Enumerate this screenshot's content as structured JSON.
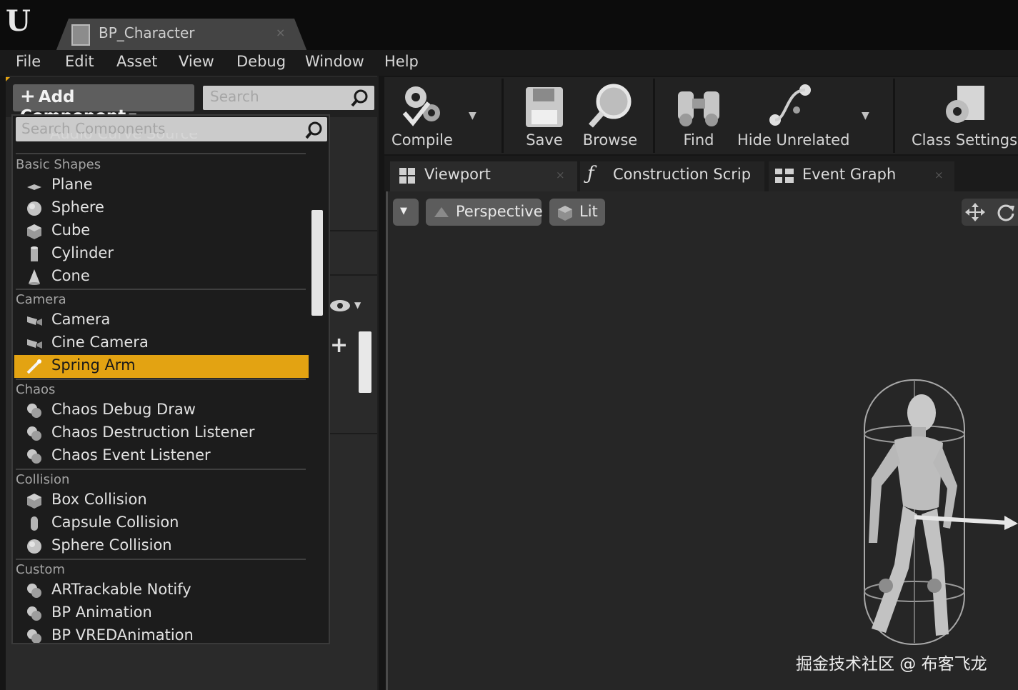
{
  "window": {
    "logo": "U",
    "tab_title": "BP_Character",
    "tab_close": "×"
  },
  "menu": [
    "File",
    "Edit",
    "Asset",
    "View",
    "Debug",
    "Window",
    "Help"
  ],
  "components_panel": {
    "add_component_label": "Add Component",
    "search_placeholder": "Search"
  },
  "component_picker": {
    "search_placeholder": "Search Components",
    "cut_off_item": "Audio Curve Source",
    "categories": [
      {
        "name": "Basic Shapes",
        "items": [
          {
            "label": "Plane",
            "icon": "plane-icon"
          },
          {
            "label": "Sphere",
            "icon": "sphere-icon"
          },
          {
            "label": "Cube",
            "icon": "cube-icon"
          },
          {
            "label": "Cylinder",
            "icon": "cylinder-icon"
          },
          {
            "label": "Cone",
            "icon": "cone-icon"
          }
        ]
      },
      {
        "name": "Camera",
        "items": [
          {
            "label": "Camera",
            "icon": "camera-icon"
          },
          {
            "label": "Cine Camera",
            "icon": "cine-camera-icon"
          },
          {
            "label": "Spring Arm",
            "icon": "spring-arm-icon",
            "selected": true
          }
        ]
      },
      {
        "name": "Chaos",
        "items": [
          {
            "label": "Chaos Debug Draw",
            "icon": "component-icon"
          },
          {
            "label": "Chaos Destruction Listener",
            "icon": "component-icon"
          },
          {
            "label": "Chaos Event Listener",
            "icon": "component-icon"
          }
        ]
      },
      {
        "name": "Collision",
        "items": [
          {
            "label": "Box Collision",
            "icon": "box-collision-icon"
          },
          {
            "label": "Capsule Collision",
            "icon": "capsule-collision-icon"
          },
          {
            "label": "Sphere Collision",
            "icon": "sphere-collision-icon"
          }
        ]
      },
      {
        "name": "Custom",
        "items": [
          {
            "label": "ARTrackable Notify",
            "icon": "component-icon"
          },
          {
            "label": "BP Animation",
            "icon": "component-icon"
          },
          {
            "label": "BP VREDAnimation",
            "icon": "component-icon"
          }
        ]
      }
    ]
  },
  "toolbar": {
    "compile": "Compile",
    "save": "Save",
    "browse": "Browse",
    "find": "Find",
    "hide_unrelated": "Hide Unrelated",
    "class_settings": "Class Settings"
  },
  "editor_tabs": {
    "viewport": "Viewport",
    "construction_script": "Construction Scrip",
    "event_graph": "Event Graph",
    "close": "×"
  },
  "viewport": {
    "perspective": "Perspective",
    "lit": "Lit"
  },
  "watermark": "掘金技术社区 @ 布客飞龙",
  "colors": {
    "selection": "#e3a312",
    "panel": "#2a2a2a",
    "viewport": "#262626"
  }
}
